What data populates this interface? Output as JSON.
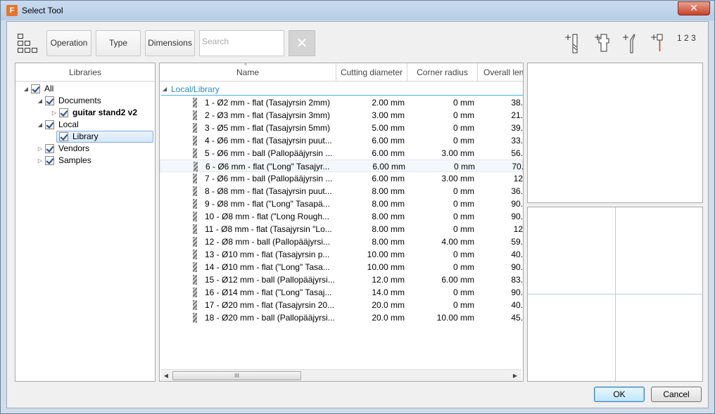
{
  "window": {
    "title": "Select Tool",
    "app_icon_letter": "F",
    "close_glyph": "✕"
  },
  "toolbar": {
    "operation_label": "Operation",
    "type_label": "Type",
    "dimensions_label": "Dimensions",
    "search_placeholder": "Search",
    "clear_glyph": "✕",
    "numbering_label": "1 2 3"
  },
  "libraries": {
    "header": "Libraries",
    "tree": [
      {
        "label": "All",
        "level": 0,
        "expanded": true,
        "checked": true,
        "bold": false
      },
      {
        "label": "Documents",
        "level": 1,
        "expanded": true,
        "checked": true,
        "bold": false
      },
      {
        "label": "guitar stand2 v2",
        "level": 2,
        "expanded": false,
        "checked": true,
        "bold": true
      },
      {
        "label": "Local",
        "level": 1,
        "expanded": true,
        "checked": true,
        "bold": false
      },
      {
        "label": "Library",
        "level": 2,
        "expanded": null,
        "checked": true,
        "bold": false,
        "selected": true
      },
      {
        "label": "Vendors",
        "level": 1,
        "expanded": false,
        "checked": true,
        "bold": false
      },
      {
        "label": "Samples",
        "level": 1,
        "expanded": false,
        "checked": true,
        "bold": false
      }
    ]
  },
  "tools_table": {
    "columns": [
      "Name",
      "Cutting diameter",
      "Corner radius",
      "Overall len"
    ],
    "group": "Local/Library",
    "rows": [
      {
        "name": "1 - Ø2 mm - flat (Tasajyrsin 2mm)",
        "dia": "2.00 mm",
        "rad": "0 mm",
        "len": "38."
      },
      {
        "name": "2 - Ø3 mm - flat (Tasajyrsin 3mm)",
        "dia": "3.00 mm",
        "rad": "0 mm",
        "len": "21."
      },
      {
        "name": "3 - Ø5 mm - flat (Tasajyrsin 5mm)",
        "dia": "5.00 mm",
        "rad": "0 mm",
        "len": "39."
      },
      {
        "name": "4 - Ø6 mm - flat (Tasajyrsin puut...",
        "dia": "6.00 mm",
        "rad": "0 mm",
        "len": "33."
      },
      {
        "name": "5 - Ø6 mm - ball (Pallopääjyrsin ...",
        "dia": "6.00 mm",
        "rad": "3.00 mm",
        "len": "56."
      },
      {
        "name": "6 - Ø6 mm - flat (\"Long\" Tasajyr...",
        "dia": "6.00 mm",
        "rad": "0 mm",
        "len": "70."
      },
      {
        "name": "7 - Ø6 mm - ball (Pallopääjyrsin ...",
        "dia": "6.00 mm",
        "rad": "3.00 mm",
        "len": "12"
      },
      {
        "name": "8 - Ø8 mm - flat (Tasajyrsin puut...",
        "dia": "8.00 mm",
        "rad": "0 mm",
        "len": "36."
      },
      {
        "name": "9 - Ø8 mm - flat (\"Long\" Tasapä...",
        "dia": "8.00 mm",
        "rad": "0 mm",
        "len": "90."
      },
      {
        "name": "10 - Ø8 mm - flat (\"Long  Rough...",
        "dia": "8.00 mm",
        "rad": "0 mm",
        "len": "90."
      },
      {
        "name": "11 - Ø8 mm - flat (Tasajyrsin \"Lo...",
        "dia": "8.00 mm",
        "rad": "0 mm",
        "len": "12"
      },
      {
        "name": "12 - Ø8 mm - ball (Pallopääjyrsi...",
        "dia": "8.00 mm",
        "rad": "4.00 mm",
        "len": "59."
      },
      {
        "name": "13 - Ø10 mm - flat (Tasajyrsin p...",
        "dia": "10.00 mm",
        "rad": "0 mm",
        "len": "40."
      },
      {
        "name": "14 - Ø10 mm - flat (\"Long\" Tasa...",
        "dia": "10.00 mm",
        "rad": "0 mm",
        "len": "90."
      },
      {
        "name": "15 - Ø12 mm - ball (Pallopääjyrsi...",
        "dia": "12.0 mm",
        "rad": "6.00 mm",
        "len": "83."
      },
      {
        "name": "16 - Ø14 mm - flat (\"Long\" Tasaj...",
        "dia": "14.0 mm",
        "rad": "0 mm",
        "len": "90."
      },
      {
        "name": "17 - Ø20 mm - flat (Tasajyrsin 20...",
        "dia": "20.0 mm",
        "rad": "0 mm",
        "len": "40."
      },
      {
        "name": "18 - Ø20 mm - ball (Pallopääjyrsi...",
        "dia": "20.0 mm",
        "rad": "10.00 mm",
        "len": "45."
      }
    ],
    "hover_row_index": 5,
    "scroll_grip": "III"
  },
  "buttons": {
    "ok_label": "OK",
    "cancel_label": "Cancel"
  },
  "colors": {
    "group_text": "#2b8bc1",
    "selection_border": "#84acdd",
    "close_red": "#c7432a"
  }
}
